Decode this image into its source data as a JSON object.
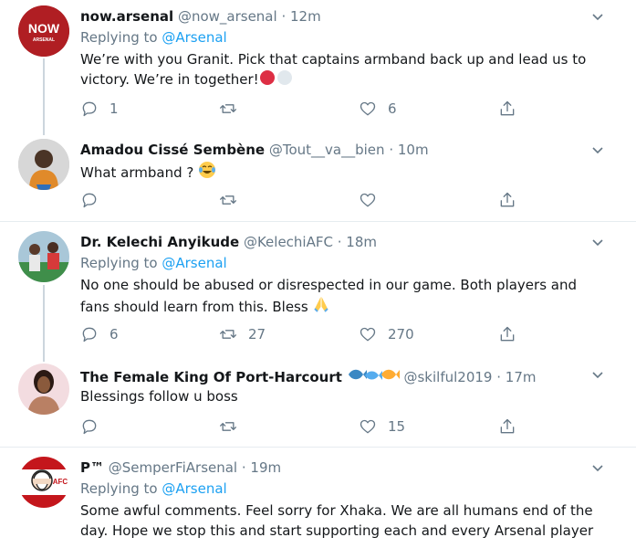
{
  "tweets": [
    {
      "name": "now.arsenal",
      "handle": "@now_arsenal",
      "time": "· 12m",
      "reply_prefix": "Replying to",
      "reply_to": "@Arsenal",
      "text": "We’re with you Granit. Pick that captains armband back up and lead us to victory. We’re in together!",
      "counts": {
        "reply": "1",
        "retweet": "",
        "like": "6"
      },
      "avatar_text_top": "NOW",
      "avatar_text_bottom": "ARSENAL"
    },
    {
      "name": "Amadou Cissé Sembène",
      "handle": "@Tout__va__bien",
      "time": "· 10m",
      "text": "What armband ?",
      "counts": {
        "reply": "",
        "retweet": "",
        "like": ""
      }
    },
    {
      "name": "Dr. Kelechi Anyikude",
      "handle": "@KelechiAFC",
      "time": "· 18m",
      "reply_prefix": "Replying to",
      "reply_to": "@Arsenal",
      "text": "No one should be abused or disrespected in our game. Both players and fans should learn from this. Bless",
      "counts": {
        "reply": "6",
        "retweet": "27",
        "like": "270"
      }
    },
    {
      "name": "The Female King Of Port-Harcourt",
      "handle": "@skilful2019",
      "time": "· 17m",
      "text": "Blessings follow u boss",
      "counts": {
        "reply": "",
        "retweet": "",
        "like": "15"
      }
    },
    {
      "name": "P™",
      "handle": "@SemperFiArsenal",
      "time": "· 19m",
      "reply_prefix": "Replying to",
      "reply_to": "@Arsenal",
      "text": "Some awful comments. Feel sorry for Xhaka. We are all humans end of the day. Hope we stop this and start supporting each and every Arsenal player",
      "avatar_text": "AFC"
    }
  ],
  "colors": {
    "accent": "#1da1f2",
    "muted": "#657786",
    "border": "#e6ecf0",
    "thread": "#ccd6dd"
  }
}
